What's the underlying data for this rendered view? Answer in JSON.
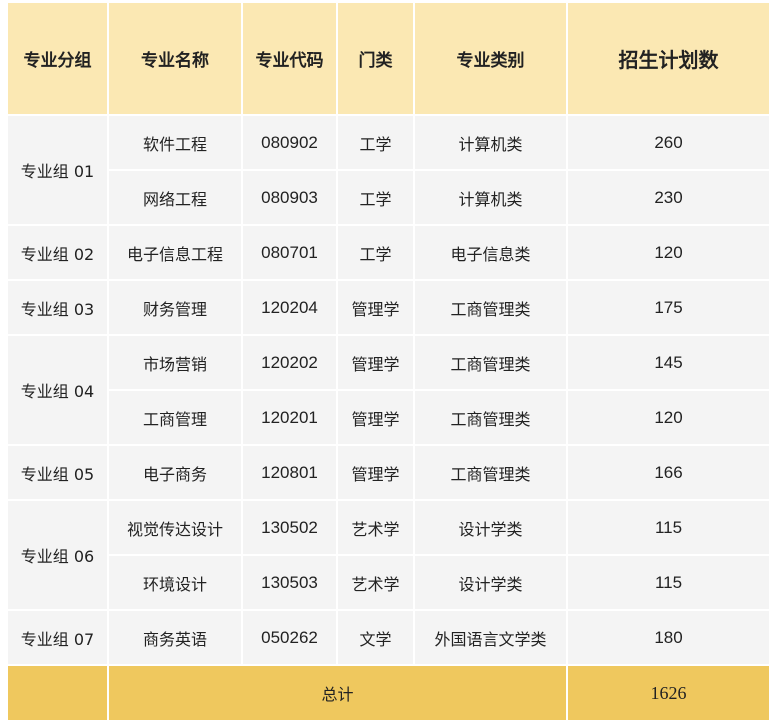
{
  "headers": [
    "专业分组",
    "专业名称",
    "专业代码",
    "门类",
    "专业类别",
    "招生计划数"
  ],
  "rows": [
    {
      "group": "专业组 01",
      "name": "软件工程",
      "code": "080902",
      "category": "工学",
      "type": "计算机类",
      "plan": "260"
    },
    {
      "name": "网络工程",
      "code": "080903",
      "category": "工学",
      "type": "计算机类",
      "plan": "230"
    },
    {
      "group": "专业组 02",
      "name": "电子信息工程",
      "code": "080701",
      "category": "工学",
      "type": "电子信息类",
      "plan": "120"
    },
    {
      "group": "专业组 03",
      "name": "财务管理",
      "code": "120204",
      "category": "管理学",
      "type": "工商管理类",
      "plan": "175"
    },
    {
      "group": "专业组 04",
      "name": "市场营销",
      "code": "120202",
      "category": "管理学",
      "type": "工商管理类",
      "plan": "145"
    },
    {
      "name": "工商管理",
      "code": "120201",
      "category": "管理学",
      "type": "工商管理类",
      "plan": "120"
    },
    {
      "group": "专业组 05",
      "name": "电子商务",
      "code": "120801",
      "category": "管理学",
      "type": "工商管理类",
      "plan": "166"
    },
    {
      "group": "专业组 06",
      "name": "视觉传达设计",
      "code": "130502",
      "category": "艺术学",
      "type": "设计学类",
      "plan": "115"
    },
    {
      "name": "环境设计",
      "code": "130503",
      "category": "艺术学",
      "type": "设计学类",
      "plan": "115"
    },
    {
      "group": "专业组 07",
      "name": "商务英语",
      "code": "050262",
      "category": "文学",
      "type": "外国语言文学类",
      "plan": "180"
    }
  ],
  "total": {
    "label": "总计",
    "value": "1626"
  },
  "colors": {
    "header_bg": "#fbe8b3",
    "row_bg": "#f4f4f4",
    "total_bg": "#efc85e"
  }
}
